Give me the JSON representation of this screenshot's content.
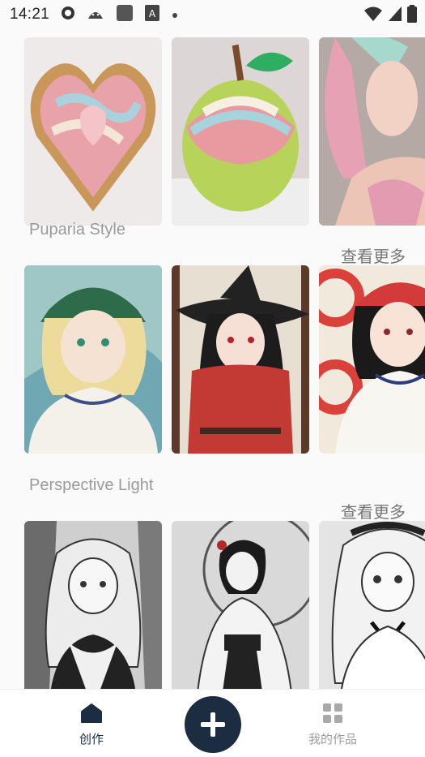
{
  "status_bar": {
    "time": "14:21",
    "icons": [
      "sync-icon",
      "android-icon",
      "app-icon",
      "font-icon",
      "dot-icon"
    ],
    "right_icons": [
      "wifi-icon",
      "signal-icon",
      "battery-icon"
    ]
  },
  "sections": [
    {
      "title": "",
      "see_more": "",
      "cards": [
        "heart-cake-image",
        "apple-cake-image",
        "pastel-girl-image"
      ]
    },
    {
      "title": "Puparia Style",
      "see_more": "查看更多",
      "cards": [
        "green-cap-girl-image",
        "witch-girl-image",
        "red-cap-girl-image"
      ]
    },
    {
      "title": "Perspective Light",
      "see_more": "查看更多",
      "cards": [
        "maid-lineart-image",
        "kimono-lineart-image",
        "maid-lineart-image-2"
      ]
    }
  ],
  "bottom_nav": {
    "create_label": "创作",
    "works_label": "我的作品",
    "active_color": "#1c2d42",
    "inactive_color": "#9e9e9e"
  }
}
